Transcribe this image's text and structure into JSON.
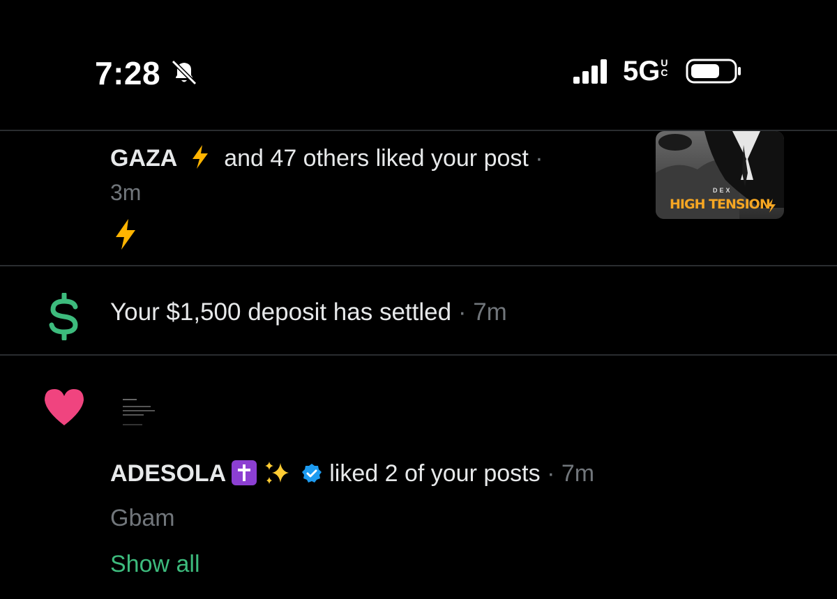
{
  "status_bar": {
    "time": "7:28",
    "network": "5G",
    "network_badge": "UC"
  },
  "notifications": [
    {
      "type": "like",
      "user": "GAZA",
      "text": "and 47 others liked your post",
      "time": "3m",
      "thumbnail": {
        "brand": "DEX",
        "title": "HIGH TENSION"
      }
    },
    {
      "type": "payment",
      "text": "Your $1,500 deposit has settled",
      "time": "7m",
      "icon": "dollar-sign-icon",
      "icon_color": "#3dbb7d"
    },
    {
      "type": "like",
      "user": "ADESOLA",
      "text": "liked 2 of your posts",
      "time": "7m",
      "post_preview": "Gbam",
      "action": "Show all",
      "icon": "heart-icon",
      "icon_color": "#f0447f"
    }
  ],
  "colors": {
    "background": "#000000",
    "primary_text": "#e7e9ea",
    "muted_text": "#71767b",
    "accent_green": "#3dbb7d",
    "heart_pink": "#f0447f",
    "verified_blue": "#1d9bf0",
    "lightning_yellow": "#ffb400"
  }
}
